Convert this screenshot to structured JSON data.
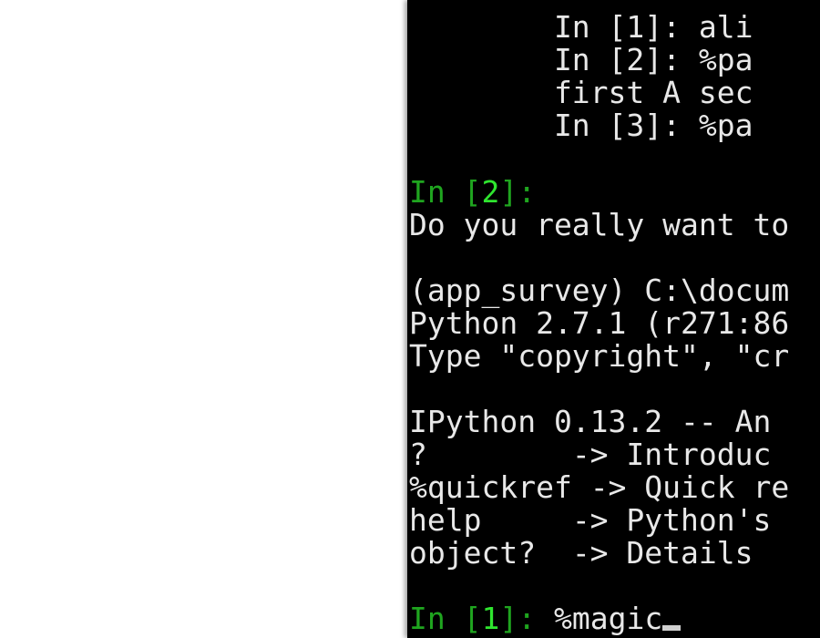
{
  "terminal": {
    "history": {
      "l1": "        In [1]: ali",
      "l2": "        In [2]: %pa",
      "l3": "        first A sec",
      "l4": "        In [3]: %pa"
    },
    "prompt_in2": {
      "open": "In [",
      "num": "2",
      "close": "]:"
    },
    "exit_question": "Do you really want to",
    "env_line": "(app_survey) C:\\docum",
    "python_version": "Python 2.7.1 (r271:86",
    "type_hint": "Type \"copyright\", \"cr",
    "ipython_banner": "IPython 0.13.2 -- An ",
    "help_rows": [
      {
        "cmd": "?        ",
        "desc": "-> Introduc"
      },
      {
        "cmd": "%quickref ",
        "desc": "-> Quick re"
      },
      {
        "cmd": "help     ",
        "desc": "-> Python's"
      },
      {
        "cmd": "object?  ",
        "desc": "-> Details "
      }
    ],
    "prompt_in1": {
      "open": "In [",
      "num": "1",
      "close": "]:"
    },
    "current_command": " %magic"
  }
}
